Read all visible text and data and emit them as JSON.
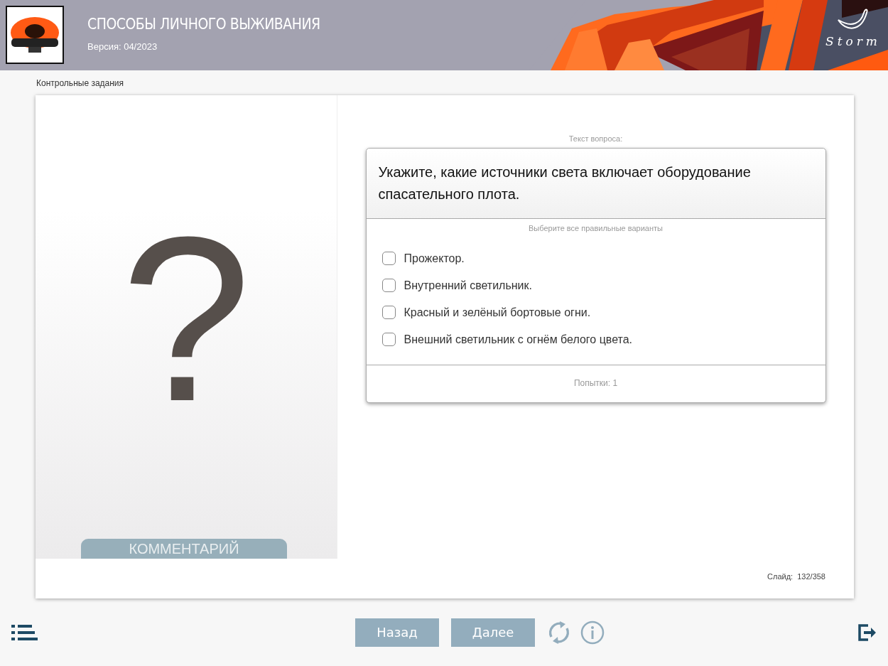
{
  "header": {
    "title": "СПОСОБЫ ЛИЧНОГО ВЫЖИВАНИЯ",
    "version": "Версия: 04/2023",
    "brand": "Storm"
  },
  "breadcrumb": "Контрольные задания",
  "left_panel": {
    "symbol": "?",
    "comment_button": "КОММЕНТАРИЙ"
  },
  "question": {
    "caption": "Текст вопроса:",
    "text": "Укажите, какие источники света включает оборудование спасательного плота.",
    "instruction": "Выберите все правильные варианты",
    "options": [
      {
        "label": "Прожектор.",
        "checked": false
      },
      {
        "label": "Внутренний светильник.",
        "checked": false
      },
      {
        "label": "Красный и зелёный бортовые огни.",
        "checked": false
      },
      {
        "label": "Внешний светильник с огнём белого цвета.",
        "checked": false
      }
    ],
    "attempts": "Попытки: 1"
  },
  "slide_counter": "Слайд:  132/358",
  "footer": {
    "back": "Назад",
    "next": "Далее"
  }
}
